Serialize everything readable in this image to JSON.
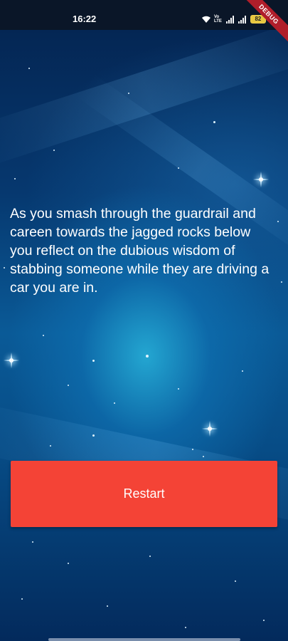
{
  "status_bar": {
    "time": "16:22",
    "battery_level": "82",
    "icons": [
      "wifi-icon",
      "volte-icon",
      "signal-icon",
      "signal-icon",
      "battery-icon"
    ]
  },
  "debug_banner": {
    "label": "DEBUG"
  },
  "story": {
    "text": "As you smash through the guardrail and careen towards the jagged rocks below you reflect on the dubious wisdom of stabbing someone while they are driving a car you are in."
  },
  "actions": {
    "restart_label": "Restart"
  },
  "colors": {
    "button": "#f44336",
    "background": "#0a5a97",
    "text": "#ffffff"
  }
}
